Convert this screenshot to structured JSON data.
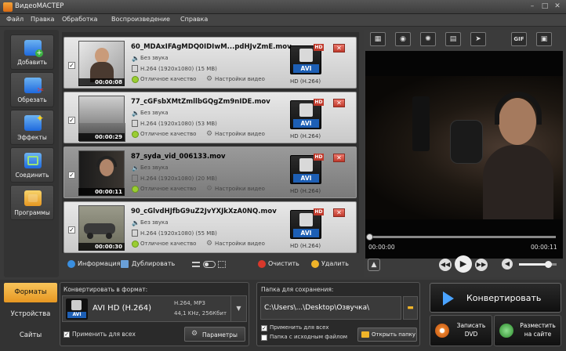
{
  "app": {
    "title": "ВидеоМАСТЕР"
  },
  "window": {
    "minimize": "–",
    "maximize": "□",
    "close": "✕"
  },
  "menu": [
    "Файл",
    "Правка",
    "Обработка",
    "Воспроизведение",
    "Справка"
  ],
  "sidebar": [
    {
      "label": "Добавить",
      "icon": "film-add-icon"
    },
    {
      "label": "Обрезать",
      "icon": "film-cut-icon"
    },
    {
      "label": "Эффекты",
      "icon": "effects-star-icon"
    },
    {
      "label": "Соединить",
      "icon": "join-icon"
    },
    {
      "label": "Программы",
      "icon": "programs-icon"
    }
  ],
  "files": [
    {
      "name": "60_MDAxIFAgMDQ0IDIwM...pdHJvZmE.mov",
      "duration": "00:00:08",
      "audio": "Без звука",
      "video": "H.264 (1920x1080) (15 MB)",
      "quality": "Отличное качество",
      "settings": "Настройки видео",
      "format": "HD (H.264)",
      "badge": "AVI",
      "hd": "HD",
      "checked": true,
      "selected": false
    },
    {
      "name": "77_cGFsbXMtZmllbGQgZm9nIDE.mov",
      "duration": "00:00:29",
      "audio": "Без звука",
      "video": "H.264 (1920x1080) (53 MB)",
      "quality": "Отличное качество",
      "settings": "Настройки видео",
      "format": "HD (H.264)",
      "badge": "AVI",
      "hd": "HD",
      "checked": true,
      "selected": false
    },
    {
      "name": "87_syda_vid_006133.mov",
      "duration": "00:00:11",
      "audio": "Без звука",
      "video": "H.264 (1920x1080) (20 MB)",
      "quality": "Отличное качество",
      "settings": "Настройки видео",
      "format": "HD (H.264)",
      "badge": "AVI",
      "hd": "HD",
      "checked": true,
      "selected": true
    },
    {
      "name": "90_cGlvdHJfbG9uZ2JvYXJkXzA0NQ.mov",
      "duration": "00:00:30",
      "audio": "Без звука",
      "video": "H.264 (1920x1080) (55 MB)",
      "quality": "Отличное качество",
      "settings": "Настройки видео",
      "format": "HD (H.264)",
      "badge": "AVI",
      "hd": "HD",
      "checked": true,
      "selected": false
    }
  ],
  "toolbar": {
    "info": "Информация",
    "duplicate": "Дублировать",
    "clear": "Очистить",
    "delete": "Удалить"
  },
  "player": {
    "tools": [
      "crop-icon",
      "rotate-icon",
      "brightness-icon",
      "subtitles-icon",
      "speed-icon",
      "gif-icon",
      "screenshot-icon"
    ],
    "gif_label": "GIF",
    "time_current": "00:00:00",
    "time_total": "00:00:11",
    "progress": 0,
    "volume": 0.75
  },
  "tabs": [
    {
      "label": "Форматы",
      "active": true
    },
    {
      "label": "Устройства",
      "active": false
    },
    {
      "label": "Сайты",
      "active": false
    }
  ],
  "format_panel": {
    "title": "Конвертировать в формат:",
    "format_name": "AVI HD (H.264)",
    "badge": "AVI",
    "details_line1": "H.264, MP3",
    "details_line2": "44,1 KHz, 256Кбит",
    "apply_all": "Применить для всех",
    "params": "Параметры"
  },
  "save_panel": {
    "title": "Папка для сохранения:",
    "path": "C:\\Users\\...\\Desktop\\Озвучка\\",
    "apply_all": "Применить для всех",
    "source_folder": "Папка с исходным файлом",
    "open_folder": "Открыть папку"
  },
  "actions": {
    "convert": "Конвертировать",
    "burn_line1": "Записать",
    "burn_line2": "DVD",
    "publish_line1": "Разместить",
    "publish_line2": "на сайте"
  },
  "colors": {
    "accent": "#f0a830",
    "format_badge": "#1d5fb5",
    "delete": "#c0392b"
  }
}
